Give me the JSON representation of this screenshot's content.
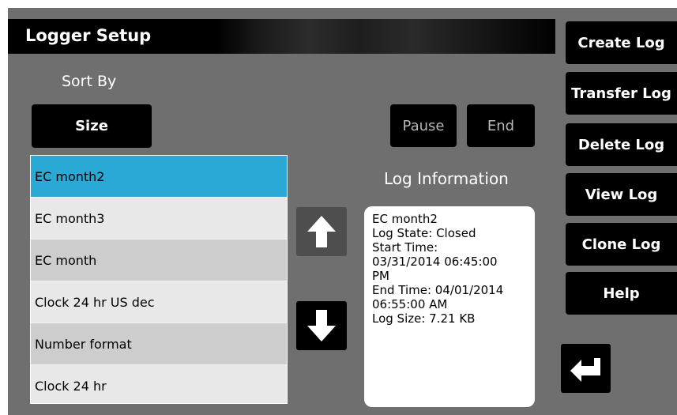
{
  "title": "Logger Setup",
  "sort": {
    "label": "Sort By",
    "value": "Size"
  },
  "controls": {
    "pause": "Pause",
    "end": "End"
  },
  "side_menu": [
    "Create Log",
    "Transfer Log",
    "Delete Log",
    "View Log",
    "Clone Log",
    "Help"
  ],
  "logs": [
    {
      "name": "EC month2",
      "selected": true
    },
    {
      "name": "EC month3",
      "selected": false
    },
    {
      "name": "EC month",
      "selected": false
    },
    {
      "name": "Clock 24 hr US dec",
      "selected": false
    },
    {
      "name": "Number format",
      "selected": false
    },
    {
      "name": "Clock 24 hr",
      "selected": false
    }
  ],
  "log_info": {
    "heading": "Log Information",
    "name": "EC month2",
    "state": "Log State: Closed",
    "start": "Start Time:\n03/31/2014 06:45:00\nPM",
    "end": "End Time: 04/01/2014\n06:55:00 AM",
    "size": "Log Size: 7.21 KB"
  },
  "icons": {
    "up": "arrow-up-icon",
    "down": "arrow-down-icon",
    "back": "return-icon"
  },
  "colors": {
    "selected_row": "#2aa8d6",
    "panel_bg": "#6f6f6f"
  }
}
